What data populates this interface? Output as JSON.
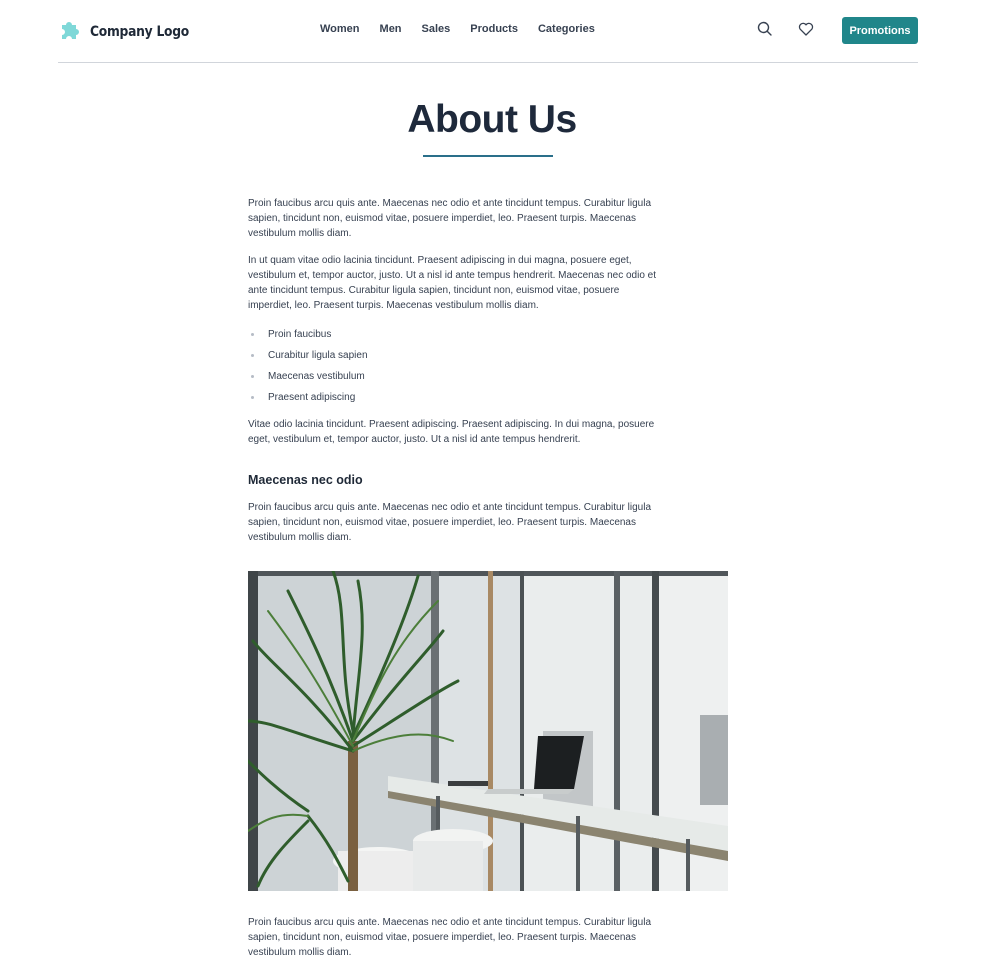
{
  "header": {
    "logo_text": "Company Logo",
    "nav": [
      "Women",
      "Men",
      "Sales",
      "Products",
      "Categories"
    ],
    "promo_label": "Promotions",
    "accent": "#20868a",
    "logo_color": "#7fd8d8"
  },
  "page": {
    "title": "About Us",
    "paragraphs": [
      "Proin faucibus arcu quis ante. Maecenas nec odio et ante tincidunt tempus. Curabitur ligula sapien, tincidunt non, euismod vitae, posuere imperdiet, leo. Praesent turpis. Maecenas vestibulum mollis diam.",
      "In ut quam vitae odio lacinia tincidunt. Praesent adipiscing in dui magna, posuere eget, vestibulum et, tempor auctor, justo. Ut a nisl id ante tempus hendrerit. Maecenas nec odio et ante tincidunt tempus. Curabitur ligula sapien, tincidunt non, euismod vitae, posuere imperdiet, leo. Praesent turpis. Maecenas vestibulum mollis diam.",
      "Vitae odio lacinia tincidunt. Praesent adipiscing. Praesent adipiscing. In dui magna, posuere eget, vestibulum et, tempor auctor, justo. Ut a nisl id ante tempus hendrerit."
    ],
    "bullets": [
      "Proin faucibus",
      "Curabitur ligula sapien",
      "Maecenas vestibulum",
      "Praesent adipiscing"
    ],
    "subheading": "Maecenas nec odio",
    "sub_paragraph": "Proin faucibus arcu quis ante. Maecenas nec odio et ante tincidunt tempus. Curabitur ligula sapien, tincidunt non, euismod vitae, posuere imperdiet, leo. Praesent turpis. Maecenas vestibulum mollis diam.",
    "image_icon": "office-plant-laptop-photo",
    "footer_paragraph": "Proin faucibus arcu quis ante. Maecenas nec odio et ante tincidunt tempus. Curabitur ligula sapien, tincidunt non, euismod vitae, posuere imperdiet, leo. Praesent turpis. Maecenas vestibulum mollis diam."
  }
}
